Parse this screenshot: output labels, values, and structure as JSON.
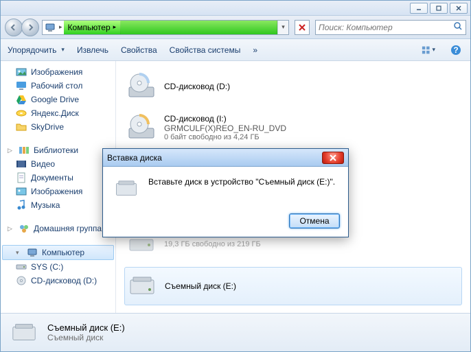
{
  "title_buttons": {
    "min": "minimize",
    "max": "maximize",
    "close": "close"
  },
  "address": {
    "segment1": "Компьютер",
    "search_placeholder": "Поиск: Компьютер"
  },
  "toolbar": {
    "organize": "Упорядочить",
    "eject": "Извлечь",
    "properties": "Свойства",
    "sysprops": "Свойства системы"
  },
  "sidebar": {
    "favorites": [
      {
        "label": "Изображения",
        "icon": "image"
      },
      {
        "label": "Рабочий стол",
        "icon": "desktop"
      },
      {
        "label": "Google Drive",
        "icon": "gdrive"
      },
      {
        "label": "Яндекс.Диск",
        "icon": "ydisk"
      },
      {
        "label": "SkyDrive",
        "icon": "skydrive"
      }
    ],
    "libraries_label": "Библиотеки",
    "libraries": [
      {
        "label": "Видео",
        "icon": "video"
      },
      {
        "label": "Документы",
        "icon": "doc"
      },
      {
        "label": "Изображения",
        "icon": "image"
      },
      {
        "label": "Музыка",
        "icon": "music"
      }
    ],
    "homegroup": "Домашняя группа",
    "computer": "Компьютер",
    "drives": [
      {
        "label": "SYS (C:)",
        "icon": "hdd"
      },
      {
        "label": "CD-дисковод (D:)",
        "icon": "cd"
      }
    ]
  },
  "content": {
    "items": [
      {
        "line1": "CD-дисковод (D:)",
        "icon": "cd"
      },
      {
        "line1": "CD-дисковод (I:)",
        "line2": "GRMCULF(X)REO_EN-RU_DVD",
        "line3": "0 байт свободно из 4,24 ГБ",
        "icon": "cd"
      },
      {
        "line3": "19,3 ГБ свободно из 219 ГБ",
        "icon": "hdd",
        "partial": true
      },
      {
        "line1": "Съемный диск (E:)",
        "icon": "removable",
        "selected": true
      }
    ]
  },
  "statusbar": {
    "line1": "Съемный диск (E:)",
    "line2": "Съемный диск"
  },
  "dialog": {
    "title": "Вставка диска",
    "message": "Вставьте диск в устройство \"Съемный диск (E:)\".",
    "cancel": "Отмена"
  }
}
